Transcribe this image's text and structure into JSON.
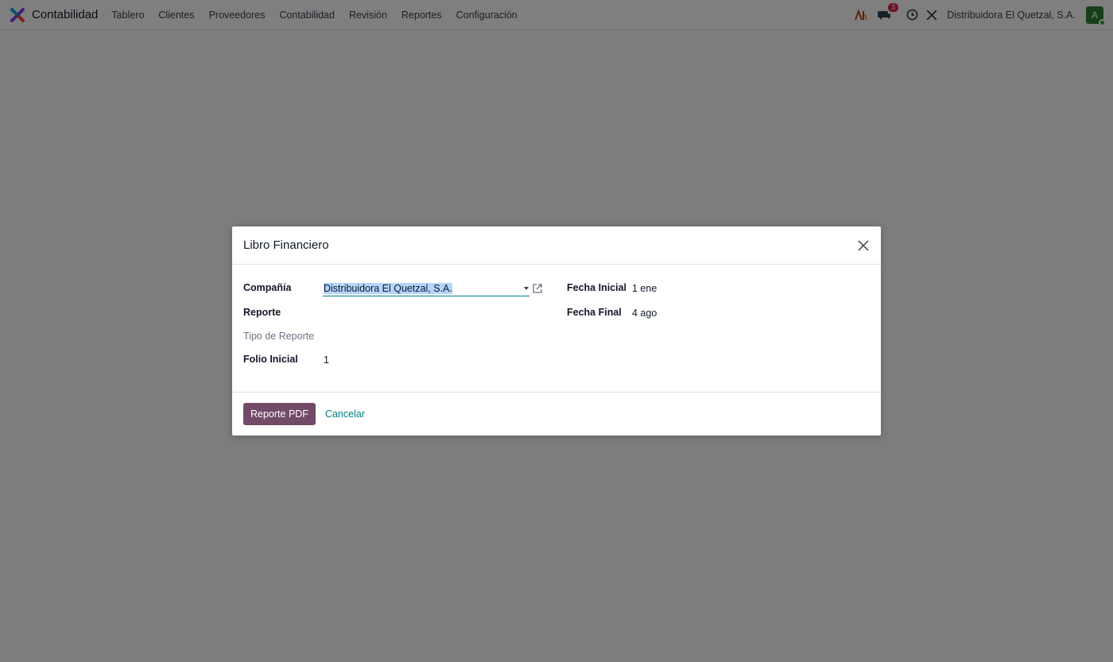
{
  "navbar": {
    "app_name": "Contabilidad",
    "menu": [
      "Tablero",
      "Clientes",
      "Proveedores",
      "Contabilidad",
      "Revisión",
      "Reportes",
      "Configuración"
    ],
    "messages_count": "3",
    "company": "Distribuidora El Quetzal, S.A.",
    "avatar_initial": "A",
    "icons": [
      "app-logo-icon",
      "ai-icon",
      "chat-icon",
      "clock-icon",
      "tools-icon"
    ]
  },
  "dialog": {
    "title": "Libro Financiero",
    "fields": {
      "company_label": "Compañía",
      "company_value": "Distribuidora El Quetzal, S.A.",
      "report_label": "Reporte",
      "report_type_label": "Tipo de Reporte",
      "folio_label": "Folio Inicial",
      "folio_value": "1",
      "start_date_label": "Fecha Inicial",
      "start_date_value": "1 ene",
      "end_date_label": "Fecha Final",
      "end_date_value": "4 ago"
    },
    "buttons": {
      "primary": "Reporte PDF",
      "cancel": "Cancelar"
    }
  },
  "colors": {
    "primary": "#714b67",
    "link": "#017e84",
    "badge": "#e11d48",
    "avatar": "#2e7d32"
  }
}
